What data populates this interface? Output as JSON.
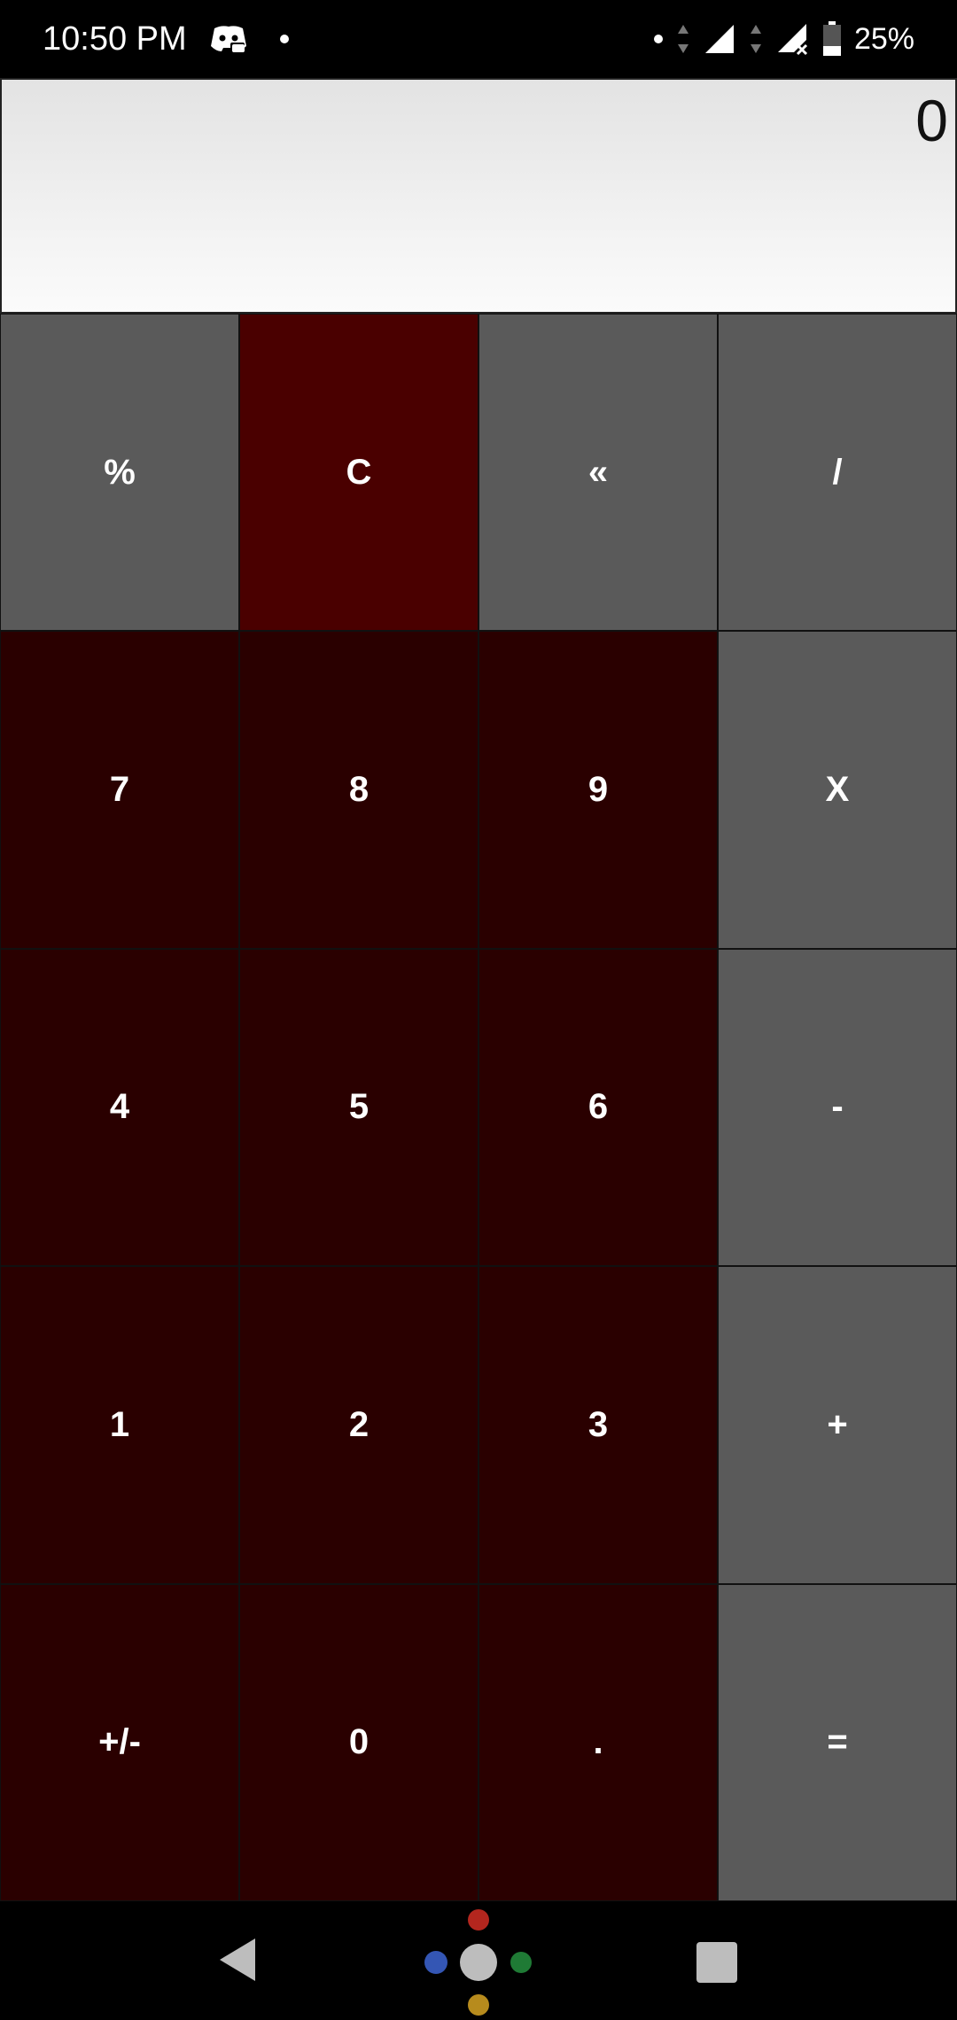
{
  "status_bar": {
    "time": "10:50 PM",
    "battery": "25%",
    "icons": [
      "discord-icon",
      "notification-dot",
      "dot",
      "data-arrows-icon",
      "signal-icon",
      "signal-no-sim-icon",
      "battery-icon"
    ]
  },
  "display": {
    "value": "0"
  },
  "keypad": {
    "rows": [
      [
        {
          "label": "%",
          "kind": "op"
        },
        {
          "label": "C",
          "kind": "clear"
        },
        {
          "label": "«",
          "kind": "op"
        },
        {
          "label": "/",
          "kind": "op"
        }
      ],
      [
        {
          "label": "7",
          "kind": "num"
        },
        {
          "label": "8",
          "kind": "num"
        },
        {
          "label": "9",
          "kind": "num"
        },
        {
          "label": "X",
          "kind": "op"
        }
      ],
      [
        {
          "label": "4",
          "kind": "num"
        },
        {
          "label": "5",
          "kind": "num"
        },
        {
          "label": "6",
          "kind": "num"
        },
        {
          "label": "-",
          "kind": "op"
        }
      ],
      [
        {
          "label": "1",
          "kind": "num"
        },
        {
          "label": "2",
          "kind": "num"
        },
        {
          "label": "3",
          "kind": "num"
        },
        {
          "label": "+",
          "kind": "op"
        }
      ],
      [
        {
          "label": "+/-",
          "kind": "num"
        },
        {
          "label": "0",
          "kind": "num"
        },
        {
          "label": ".",
          "kind": "num"
        },
        {
          "label": "=",
          "kind": "op"
        }
      ]
    ]
  },
  "colors": {
    "operator_key": "#5a5a5a",
    "clear_key": "#4a0000",
    "number_key": "#2a0000",
    "display_bg": "#eeeeee"
  },
  "nav_bar": {
    "icons": [
      "back-icon",
      "assistant-home-icon",
      "recents-icon"
    ]
  }
}
